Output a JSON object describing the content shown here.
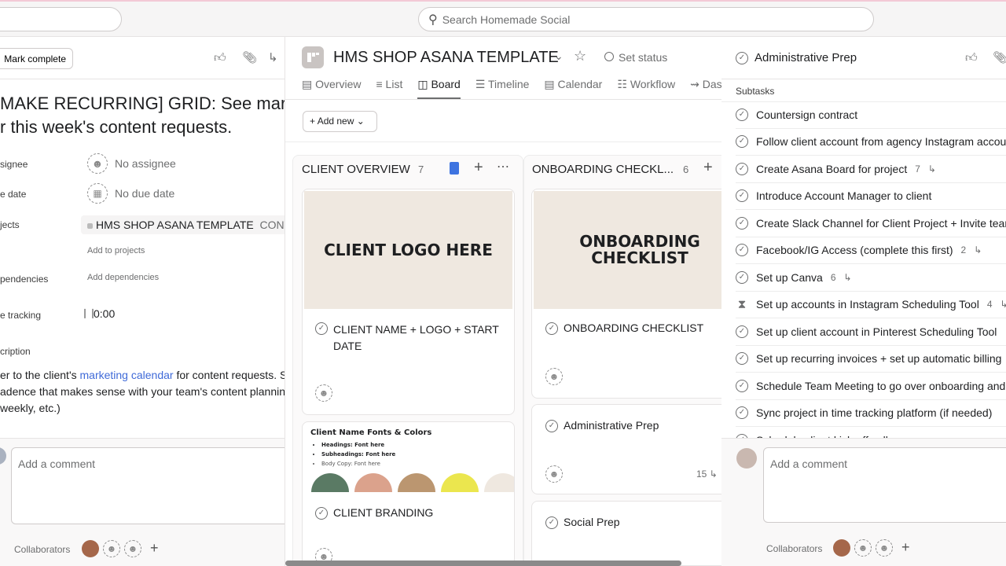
{
  "search": {
    "placeholder": "Search Homemade Social"
  },
  "left": {
    "mark_complete": "Mark complete",
    "title_line1": "MAKE RECURRING] GRID: See marke",
    "title_line2": "r this week's content requests.",
    "fields": {
      "assignee_label": "signee",
      "assignee_value": "No assignee",
      "due_label": "e date",
      "due_value": "No due date",
      "projects_label": "jects",
      "project_name": "HMS SHOP ASANA TEMPLATE",
      "project_section": "CONTE",
      "add_projects": "Add to projects",
      "dependencies_label": "pendencies",
      "add_dependencies": "Add dependencies",
      "time_label": "e tracking",
      "time_value": "0:00",
      "description_label": "cription"
    },
    "description": {
      "line1_pre": "er to the client's ",
      "link": "marketing calendar",
      "line1_post": " for content requests. S",
      "line2": "adence that makes sense with your team's content planning",
      "line3": "weekly, etc.)"
    },
    "comment_placeholder": "Add a comment",
    "collaborators_label": "Collaborators"
  },
  "project": {
    "title": "HMS SHOP ASANA TEMPLATE",
    "set_status": "Set status",
    "tabs": [
      {
        "label": "Overview"
      },
      {
        "label": "List"
      },
      {
        "label": "Board"
      },
      {
        "label": "Timeline"
      },
      {
        "label": "Calendar"
      },
      {
        "label": "Workflow"
      },
      {
        "label": "Das"
      }
    ],
    "add_new": "Add new",
    "columns": [
      {
        "title": "CLIENT OVERVIEW",
        "count": "7",
        "cards": [
          {
            "cover": "CLIENT LOGO HERE",
            "title": "CLIENT NAME + LOGO + START DATE"
          },
          {
            "cover_title": "Client Name Fonts & Colors",
            "bullets": [
              "Headings: Font here",
              "Subheadings: Font here",
              "Body Copy: Font here"
            ],
            "swatches": [
              "#5a7a64",
              "#dba28c",
              "#bb9670",
              "#ebe64e",
              "#efe8e0"
            ],
            "title": "CLIENT BRANDING"
          }
        ]
      },
      {
        "title": "ONBOARDING CHECKL...",
        "count": "6",
        "cards": [
          {
            "cover": "ONBOARDING CHECKLIST",
            "title": "ONBOARDING CHECKLIST"
          },
          {
            "title": "Administrative Prep",
            "subtasks": "15"
          },
          {
            "title": "Social Prep"
          }
        ]
      }
    ]
  },
  "right": {
    "title": "Administrative Prep",
    "subtasks_label": "Subtasks",
    "subtasks": [
      {
        "name": "Countersign contract",
        "count": ""
      },
      {
        "name": "Follow client account from agency Instagram account",
        "count": ""
      },
      {
        "name": "Create Asana Board for project",
        "count": "7"
      },
      {
        "name": "Introduce Account Manager to client",
        "count": ""
      },
      {
        "name": "Create Slack Channel for Client Project + Invite team",
        "count": ""
      },
      {
        "name": "Facebook/IG Access (complete this first)",
        "count": "2"
      },
      {
        "name": "Set up Canva",
        "count": "6"
      },
      {
        "name": "Set up accounts in Instagram Scheduling Tool",
        "count": "4",
        "pending": true
      },
      {
        "name": "Set up client account in Pinterest Scheduling Tool",
        "count": ""
      },
      {
        "name": "Set up recurring invoices + set up automatic billing",
        "count": ""
      },
      {
        "name": "Schedule Team Meeting to go over onboarding and",
        "count": ""
      },
      {
        "name": "Sync project in time tracking platform (if needed)",
        "count": ""
      },
      {
        "name": "Schedule client kick-off call",
        "count": ""
      }
    ],
    "comment_placeholder": "Add a comment",
    "collaborators_label": "Collaborators"
  }
}
